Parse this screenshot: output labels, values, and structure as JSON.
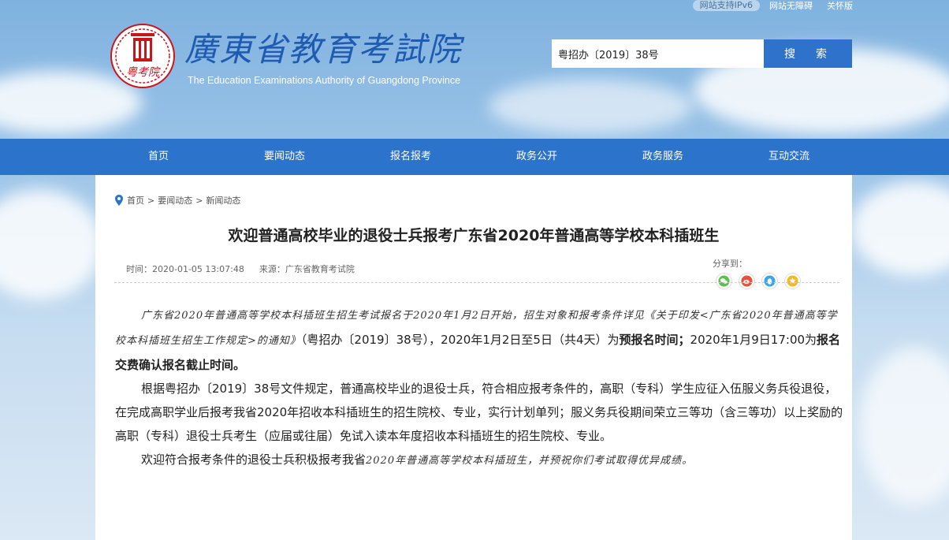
{
  "topbar": {
    "ipv6": "网站支持IPv6",
    "accessible": "网站无障碍",
    "elder": "关怀版"
  },
  "logo": {
    "seal_text": "粤考院",
    "cn": "廣東省教育考試院",
    "en": "The Education Examinations Authority of Guangdong Province"
  },
  "search": {
    "value": "粤招办〔2019〕38号",
    "button": "搜　索"
  },
  "nav": [
    "首页",
    "要闻动态",
    "报名报考",
    "政务公开",
    "政务服务",
    "互动交流"
  ],
  "breadcrumb": [
    "首页",
    "要闻动态",
    "新闻动态"
  ],
  "breadcrumb_sep": ">",
  "article": {
    "title": "欢迎普通高校毕业的退役士兵报考广东省2020年普通高等学校本科插班生",
    "time": "时间：2020-01-05 13:07:48",
    "source": "来源：广东省教育考试院",
    "share_label": "分享到：",
    "share_icons": [
      "wechat-icon",
      "weibo-icon",
      "qq-icon",
      "qzone-icon"
    ],
    "p1_hand_a": "广东省2020年普通高等学校本科插班生招生考试报名于2020年1月2日开始，招生对象和报考条件详见《关于印发<广东省2020年普通高等学校本科插班生招生工作规定>的通知》",
    "p1_b": "（粤招办〔2019〕38号），2020年1月2日至5日（共4天）为",
    "p1_bold1": "预报名时间；",
    "p1_c": "2020年1月9日17:00为",
    "p1_bold2": "报名交费确认报名截止时间。",
    "p2": "根据粤招办〔2019〕38号文件规定，普通高校毕业的退役士兵，符合相应报考条件的，高职（专科）学生应征入伍服义务兵役退役，在完成高职学业后报考我省2020年招收本科插班生的招生院校、专业，实行计划单列；服义务兵役期间荣立三等功（含三等功）以上奖励的高职（专科）退役士兵考生（应届或往届）免试入读本年度招收本科插班生的招生院校、专业。",
    "p3_a": "欢迎符合报考条件的退役士兵积极报考我省",
    "p3_hand": "2020年普通高等学校本科插班生，并预祝你们考试取得优异成绩。"
  },
  "colors": {
    "nav": "#2c73cc",
    "search_button": "#2f72cc",
    "logo_red": "#c8161d",
    "logo_blue": "#1f5bb0"
  }
}
